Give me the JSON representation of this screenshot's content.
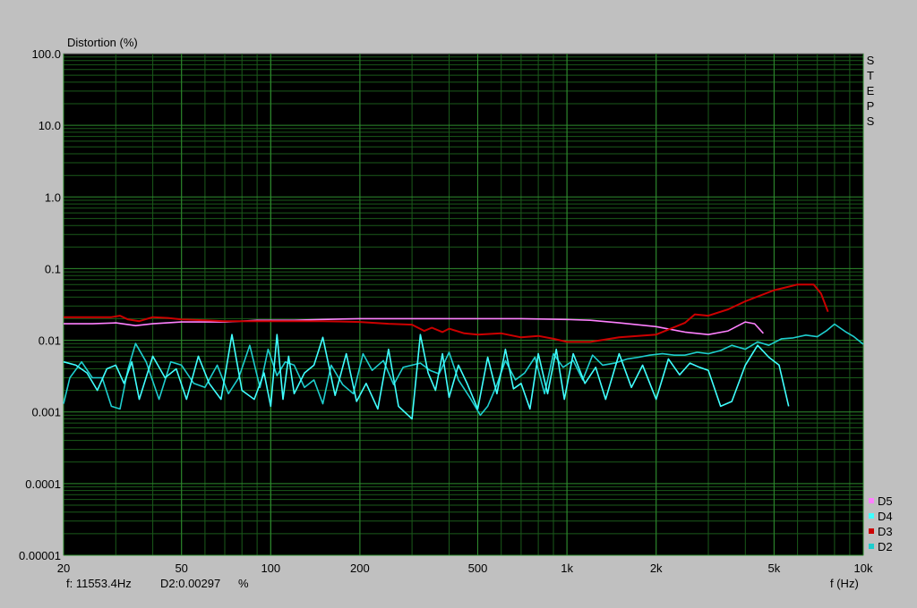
{
  "chart_data": {
    "type": "line",
    "ylabel": "Distortion (%)",
    "xlabel": "f (Hz)",
    "x_scale": "log",
    "y_scale": "log",
    "xlim": [
      20,
      10000
    ],
    "ylim": [
      1e-05,
      100
    ],
    "grid": true,
    "x_ticks": [
      {
        "value": 20,
        "label": "20"
      },
      {
        "value": 50,
        "label": "50"
      },
      {
        "value": 100,
        "label": "100"
      },
      {
        "value": 200,
        "label": "200"
      },
      {
        "value": 500,
        "label": "500"
      },
      {
        "value": 1000,
        "label": "1k"
      },
      {
        "value": 2000,
        "label": "2k"
      },
      {
        "value": 5000,
        "label": "5k"
      },
      {
        "value": 10000,
        "label": "10k"
      }
    ],
    "y_ticks": [
      {
        "value": 100,
        "label": "100.0"
      },
      {
        "value": 10,
        "label": "10.0"
      },
      {
        "value": 1,
        "label": "1.0"
      },
      {
        "value": 0.1,
        "label": "0.1"
      },
      {
        "value": 0.01,
        "label": "0.01"
      },
      {
        "value": 0.001,
        "label": "0.001"
      },
      {
        "value": 0.0001,
        "label": "0.0001"
      },
      {
        "value": 1e-05,
        "label": "0.00001"
      }
    ],
    "side_label": "STEPS",
    "legend_position": "bottom-right",
    "series": [
      {
        "name": "D5",
        "color": "#ff80ff",
        "x": [
          20,
          25,
          30,
          35,
          40,
          50,
          60,
          70,
          80,
          90,
          100,
          120,
          150,
          200,
          300,
          500,
          700,
          1000,
          1200,
          1500,
          2000,
          2500,
          3000,
          3500,
          4000,
          4300,
          4600
        ],
        "y": [
          0.017,
          0.017,
          0.0175,
          0.016,
          0.017,
          0.018,
          0.018,
          0.018,
          0.0185,
          0.019,
          0.019,
          0.019,
          0.0195,
          0.02,
          0.02,
          0.02,
          0.02,
          0.0195,
          0.019,
          0.0175,
          0.0155,
          0.013,
          0.012,
          0.0135,
          0.018,
          0.017,
          0.0125
        ]
      },
      {
        "name": "D3",
        "color": "#cc0000",
        "x": [
          20,
          25,
          29,
          31,
          33,
          36,
          40,
          45,
          50,
          60,
          70,
          80,
          100,
          150,
          200,
          250,
          300,
          330,
          350,
          380,
          400,
          450,
          500,
          600,
          700,
          800,
          900,
          1000,
          1200,
          1500,
          2000,
          2500,
          2700,
          3000,
          3500,
          4000,
          5000,
          6000,
          6800,
          7200,
          7600
        ],
        "y": [
          0.021,
          0.021,
          0.021,
          0.022,
          0.0195,
          0.0185,
          0.021,
          0.0205,
          0.0195,
          0.019,
          0.0185,
          0.0185,
          0.0185,
          0.0185,
          0.018,
          0.017,
          0.0165,
          0.0135,
          0.015,
          0.013,
          0.0145,
          0.0125,
          0.012,
          0.0125,
          0.011,
          0.0115,
          0.0105,
          0.0095,
          0.0095,
          0.011,
          0.012,
          0.0175,
          0.023,
          0.022,
          0.027,
          0.035,
          0.05,
          0.06,
          0.06,
          0.045,
          0.025
        ]
      },
      {
        "name": "D4",
        "color": "#40ffff",
        "x": [
          20,
          22,
          24,
          26,
          28,
          30,
          32,
          34,
          36,
          40,
          44,
          48,
          52,
          57,
          62,
          68,
          74,
          80,
          88,
          95,
          100,
          105,
          110,
          115,
          120,
          130,
          140,
          150,
          165,
          180,
          195,
          210,
          230,
          250,
          270,
          300,
          320,
          340,
          360,
          380,
          400,
          430,
          460,
          500,
          540,
          580,
          620,
          660,
          700,
          750,
          800,
          860,
          920,
          980,
          1050,
          1150,
          1250,
          1350,
          1500,
          1650,
          1800,
          2000,
          2200,
          2400,
          2600,
          2800,
          3000,
          3300,
          3600,
          4000,
          4400,
          4800,
          5200,
          5600
        ],
        "y": [
          0.005,
          0.0045,
          0.0035,
          0.002,
          0.004,
          0.0045,
          0.0025,
          0.005,
          0.0015,
          0.006,
          0.003,
          0.004,
          0.0015,
          0.006,
          0.0025,
          0.0015,
          0.012,
          0.002,
          0.0015,
          0.0035,
          0.0012,
          0.012,
          0.0015,
          0.006,
          0.0018,
          0.0035,
          0.0045,
          0.011,
          0.0017,
          0.0065,
          0.0014,
          0.0025,
          0.0011,
          0.0075,
          0.0012,
          0.0008,
          0.012,
          0.0035,
          0.002,
          0.0065,
          0.0016,
          0.0045,
          0.0025,
          0.0011,
          0.0058,
          0.0018,
          0.0075,
          0.0021,
          0.0025,
          0.0011,
          0.0065,
          0.0018,
          0.0075,
          0.0015,
          0.0065,
          0.0025,
          0.0042,
          0.0015,
          0.0065,
          0.0022,
          0.0045,
          0.0015,
          0.0055,
          0.0033,
          0.0048,
          0.0042,
          0.0038,
          0.0012,
          0.0014,
          0.0045,
          0.0085,
          0.0058,
          0.0045,
          0.0012
        ]
      },
      {
        "name": "D2",
        "color": "#1ecece",
        "x": [
          20,
          21,
          23,
          25,
          27,
          29,
          31,
          33,
          35,
          38,
          42,
          46,
          50,
          55,
          60,
          66,
          72,
          78,
          85,
          92,
          98,
          105,
          112,
          120,
          130,
          140,
          150,
          160,
          175,
          190,
          205,
          220,
          240,
          260,
          280,
          300,
          320,
          345,
          370,
          400,
          430,
          470,
          510,
          540,
          580,
          620,
          670,
          720,
          780,
          840,
          900,
          970,
          1050,
          1130,
          1220,
          1320,
          1450,
          1600,
          1750,
          1900,
          2100,
          2300,
          2500,
          2750,
          3000,
          3300,
          3600,
          4000,
          4400,
          4800,
          5300,
          5800,
          6400,
          7000,
          7500,
          8000,
          8700,
          9300,
          10000
        ],
        "y": [
          0.0013,
          0.003,
          0.005,
          0.003,
          0.003,
          0.0012,
          0.0011,
          0.004,
          0.009,
          0.005,
          0.0015,
          0.005,
          0.0045,
          0.0025,
          0.0022,
          0.0045,
          0.0018,
          0.003,
          0.0085,
          0.0022,
          0.0075,
          0.0032,
          0.005,
          0.0045,
          0.0022,
          0.0028,
          0.0013,
          0.0045,
          0.0024,
          0.0018,
          0.0065,
          0.0038,
          0.0052,
          0.0024,
          0.0042,
          0.0045,
          0.0048,
          0.0038,
          0.0034,
          0.0068,
          0.0028,
          0.0016,
          0.0009,
          0.0012,
          0.0024,
          0.0052,
          0.0028,
          0.0035,
          0.0058,
          0.0018,
          0.0065,
          0.0042,
          0.0052,
          0.0028,
          0.0062,
          0.0045,
          0.0048,
          0.0055,
          0.0058,
          0.0062,
          0.0065,
          0.0062,
          0.0062,
          0.0068,
          0.0065,
          0.0072,
          0.0085,
          0.0075,
          0.0095,
          0.0085,
          0.0105,
          0.0108,
          0.0118,
          0.0112,
          0.0135,
          0.0168,
          0.0132,
          0.0112,
          0.0088
        ]
      }
    ]
  },
  "status": {
    "freq_readout": "f: 11553.4Hz",
    "value_readout": "D2:0.00297",
    "unit": "%"
  }
}
